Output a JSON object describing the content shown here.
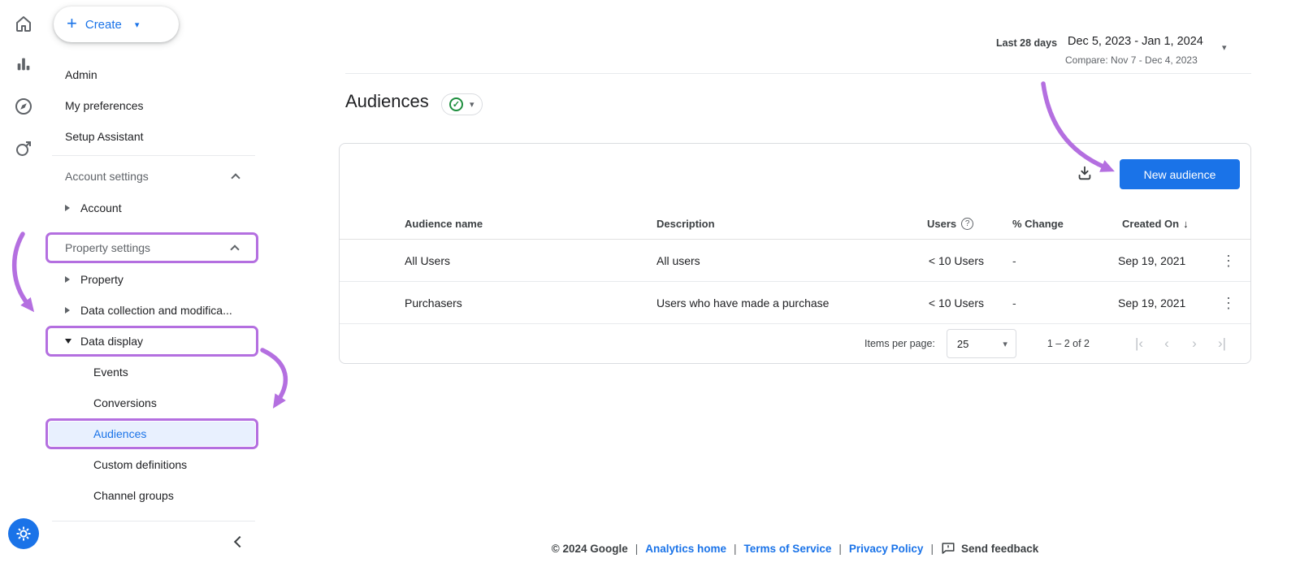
{
  "colors": {
    "accent": "#1a73e8",
    "annotation": "#b46fe0"
  },
  "icons": {
    "plus": "+",
    "caret_down": "▾",
    "check": "✓",
    "question": "?",
    "kebab": "⋮",
    "sort_down": "↓",
    "page_first": "|‹",
    "page_prev": "‹",
    "page_next": "›",
    "page_last": "›|"
  },
  "sidebar": {
    "create_label": "Create",
    "items_top": [
      "Admin",
      "My preferences",
      "Setup Assistant"
    ],
    "sections": {
      "account_settings": "Account settings",
      "account": "Account",
      "property_settings": "Property settings",
      "property": "Property",
      "data_collection": "Data collection and modifica...",
      "data_display": "Data display"
    },
    "sub_items": [
      "Events",
      "Conversions",
      "Audiences",
      "Custom definitions",
      "Channel groups"
    ]
  },
  "header": {
    "preset": "Last 28 days",
    "range": "Dec 5, 2023 - Jan 1, 2024",
    "compare": "Compare: Nov 7 - Dec 4, 2023"
  },
  "page": {
    "title": "Audiences"
  },
  "table": {
    "new_audience": "New audience",
    "headers": [
      "Audience name",
      "Description",
      "Users",
      "% Change",
      "Created On"
    ],
    "rows": [
      {
        "name": "All Users",
        "description": "All users",
        "users": "< 10 Users",
        "change": "-",
        "created": "Sep 19, 2021"
      },
      {
        "name": "Purchasers",
        "description": "Users who have made a purchase",
        "users": "< 10 Users",
        "change": "-",
        "created": "Sep 19, 2021"
      }
    ],
    "items_per_page_label": "Items per page:",
    "items_per_page_value": "25",
    "range_label": "1 – 2 of 2"
  },
  "footer": {
    "copyright": "© 2024 Google",
    "links": [
      "Analytics home",
      "Terms of Service",
      "Privacy Policy"
    ],
    "feedback": "Send feedback"
  }
}
